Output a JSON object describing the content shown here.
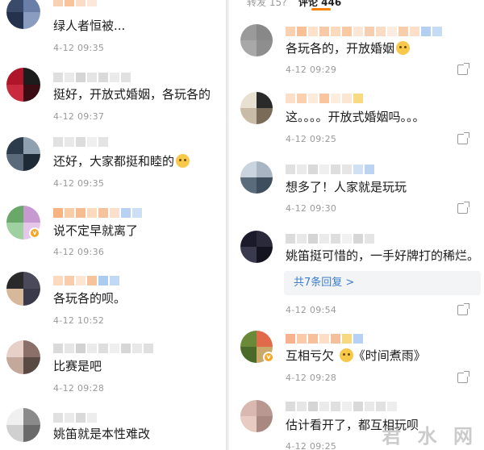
{
  "left_comments": [
    {
      "text": "绿人者恒被...",
      "time": "4-12 09:35"
    },
    {
      "text": "挺好，开放式婚姻，各玩各的",
      "time": "4-12 09:37"
    },
    {
      "text": "还好，大家都挺和睦的",
      "time": "4-12 09:35",
      "emoji": true
    },
    {
      "text": "说不定早就离了",
      "time": "4-12 09:36"
    },
    {
      "text": "各玩各的呗。",
      "time": "4-12 10:52"
    },
    {
      "text": "比赛是吧",
      "time": "4-12 09:28"
    },
    {
      "text": "姚笛就是本性难改",
      "time": ""
    }
  ],
  "right_tabs": {
    "left_tab": "转发 15?",
    "active_tab": "评论 446"
  },
  "right_comments": [
    {
      "text": "各玩各的，开放婚姻",
      "time": "4-12 09:29",
      "emoji": true
    },
    {
      "text": "这。。。。开放式婚姻吗。。。",
      "time": "4-12 09:25"
    },
    {
      "text": "想多了！人家就是玩玩",
      "time": "4-12 09:30"
    },
    {
      "text": "姚笛挺可惜的，一手好牌打的稀烂。",
      "time": "4-12 09:54",
      "reply": "共7条回复 >"
    },
    {
      "text_before": "互相亏欠",
      "text_after": "《时间煮雨》",
      "time": "4-12 09:28",
      "emoji": true
    },
    {
      "text": "估计看开了，都互相玩呗",
      "time": "4-12 09:25"
    }
  ],
  "watermark": "君 水 网"
}
